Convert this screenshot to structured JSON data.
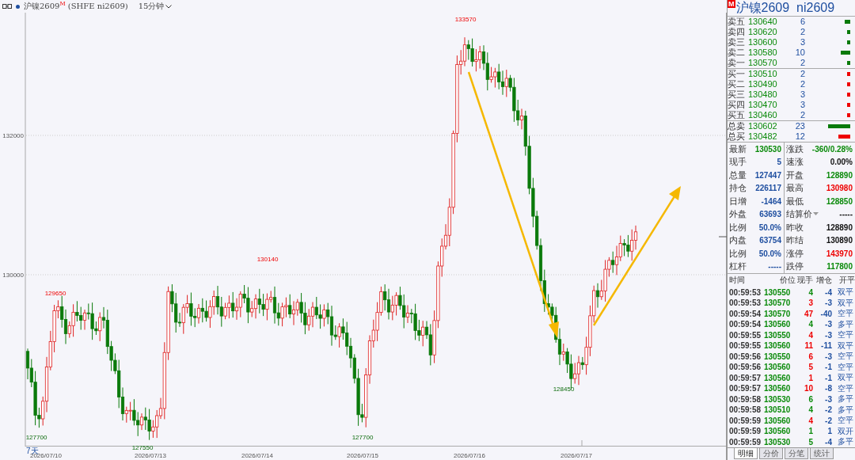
{
  "header": {
    "title": "沪镍2609",
    "mark": "M",
    "code": "(SHFE  ni2609)",
    "period": "15分钟"
  },
  "chart": {
    "y_ticks": [
      "132000",
      "130000"
    ],
    "range_label": "7天",
    "price_labels": [
      {
        "text": "133570",
        "kind": "high"
      },
      {
        "text": "129650",
        "kind": "high"
      },
      {
        "text": "130140",
        "kind": "high"
      },
      {
        "text": "127700",
        "kind": "low"
      },
      {
        "text": "127550",
        "kind": "low"
      },
      {
        "text": "127700",
        "kind": "low"
      },
      {
        "text": "128450",
        "kind": "low"
      }
    ],
    "dates": [
      "2026/07/10",
      "2026/07/13",
      "2026/07/14",
      "2026/07/15",
      "2026/07/16",
      "2026/07/17"
    ]
  },
  "quote": {
    "mark": "M",
    "name": "沪镍2609",
    "code": "ni2609",
    "book": [
      {
        "label": "卖五",
        "price": "130640",
        "volume": "6",
        "kind": "sell"
      },
      {
        "label": "卖四",
        "price": "130620",
        "volume": "2",
        "kind": "sell"
      },
      {
        "label": "卖三",
        "price": "130600",
        "volume": "3",
        "kind": "sell"
      },
      {
        "label": "卖二",
        "price": "130580",
        "volume": "10",
        "kind": "sell"
      },
      {
        "label": "卖一",
        "price": "130570",
        "volume": "2",
        "kind": "sell"
      },
      {
        "label": "买一",
        "price": "130510",
        "volume": "2",
        "kind": "buy"
      },
      {
        "label": "买二",
        "price": "130490",
        "volume": "2",
        "kind": "buy"
      },
      {
        "label": "买三",
        "price": "130480",
        "volume": "3",
        "kind": "buy"
      },
      {
        "label": "买四",
        "price": "130470",
        "volume": "3",
        "kind": "buy"
      },
      {
        "label": "买五",
        "price": "130460",
        "volume": "2",
        "kind": "buy"
      }
    ],
    "totals": [
      {
        "label": "总卖",
        "price": "130602",
        "volume": "23",
        "kind": "sell"
      },
      {
        "label": "总买",
        "price": "130482",
        "volume": "12",
        "kind": "buy"
      }
    ],
    "stats": [
      [
        {
          "label": "最新",
          "value": "130530",
          "kind": "green"
        },
        {
          "label": "涨跌",
          "value": "-360/0.28%",
          "kind": "green"
        }
      ],
      [
        {
          "label": "现手",
          "value": "5",
          "kind": "blue"
        },
        {
          "label": "速涨",
          "value": "0.00%",
          "kind": "black"
        }
      ],
      [
        {
          "label": "总量",
          "value": "127447",
          "kind": "blue"
        },
        {
          "label": "开盘",
          "value": "128890",
          "kind": "green"
        }
      ],
      [
        {
          "label": "持仓",
          "value": "226117",
          "kind": "blue"
        },
        {
          "label": "最高",
          "value": "130980",
          "kind": "red"
        }
      ],
      [
        {
          "label": "日增",
          "value": "-1464",
          "kind": "blue"
        },
        {
          "label": "最低",
          "value": "128850",
          "kind": "green"
        }
      ],
      [
        {
          "label": "外盘",
          "value": "63693",
          "kind": "blue"
        },
        {
          "label": "结算价",
          "value": "-----",
          "kind": "black",
          "dropdown": true
        }
      ],
      [
        {
          "label": "比例",
          "value": "50.0%",
          "kind": "blue"
        },
        {
          "label": "昨收",
          "value": "128890",
          "kind": "black"
        }
      ],
      [
        {
          "label": "内盘",
          "value": "63754",
          "kind": "blue"
        },
        {
          "label": "昨结",
          "value": "130890",
          "kind": "black"
        }
      ],
      [
        {
          "label": "比例",
          "value": "50.0%",
          "kind": "blue"
        },
        {
          "label": "涨停",
          "value": "143970",
          "kind": "red"
        }
      ],
      [
        {
          "label": "杠杆",
          "value": "-----",
          "kind": "blue"
        },
        {
          "label": "跌停",
          "value": "117800",
          "kind": "green"
        }
      ]
    ],
    "trades_header": [
      "时间",
      "价位",
      "现手",
      "增仓",
      "开平"
    ],
    "trades": [
      {
        "time": "00:59:53",
        "price": "130550",
        "hand": "4",
        "kind": "down",
        "change": "-4",
        "type": "双平"
      },
      {
        "time": "00:59:53",
        "price": "130570",
        "hand": "3",
        "kind": "up",
        "change": "-3",
        "type": "双平"
      },
      {
        "time": "00:59:54",
        "price": "130570",
        "hand": "47",
        "kind": "up",
        "change": "-40",
        "type": "空平"
      },
      {
        "time": "00:59:54",
        "price": "130560",
        "hand": "4",
        "kind": "down",
        "change": "-3",
        "type": "多平"
      },
      {
        "time": "00:59:55",
        "price": "130550",
        "hand": "4",
        "kind": "up",
        "change": "-3",
        "type": "空平"
      },
      {
        "time": "00:59:55",
        "price": "130560",
        "hand": "11",
        "kind": "up",
        "change": "-11",
        "type": "双平"
      },
      {
        "time": "00:59:56",
        "price": "130550",
        "hand": "6",
        "kind": "up",
        "change": "-3",
        "type": "空平"
      },
      {
        "time": "00:59:56",
        "price": "130560",
        "hand": "5",
        "kind": "up",
        "change": "-1",
        "type": "空平"
      },
      {
        "time": "00:59:57",
        "price": "130560",
        "hand": "1",
        "kind": "up",
        "change": "-1",
        "type": "双平"
      },
      {
        "time": "00:59:57",
        "price": "130560",
        "hand": "10",
        "kind": "up",
        "change": "-8",
        "type": "空平"
      },
      {
        "time": "00:59:58",
        "price": "130530",
        "hand": "6",
        "kind": "down",
        "change": "-3",
        "type": "多平"
      },
      {
        "time": "00:59:58",
        "price": "130510",
        "hand": "4",
        "kind": "down",
        "change": "-2",
        "type": "多平"
      },
      {
        "time": "00:59:59",
        "price": "130560",
        "hand": "4",
        "kind": "up",
        "change": "-2",
        "type": "空平"
      },
      {
        "time": "00:59:59",
        "price": "130560",
        "hand": "1",
        "kind": "down",
        "change": "1",
        "type": "双开"
      },
      {
        "time": "00:59:59",
        "price": "130530",
        "hand": "5",
        "kind": "down",
        "change": "-4",
        "type": "多平"
      }
    ],
    "tabs": [
      {
        "label": "明细",
        "selected": true
      },
      {
        "label": "分价",
        "selected": false
      },
      {
        "label": "分笔",
        "selected": false
      },
      {
        "label": "统计",
        "selected": false
      }
    ]
  }
}
